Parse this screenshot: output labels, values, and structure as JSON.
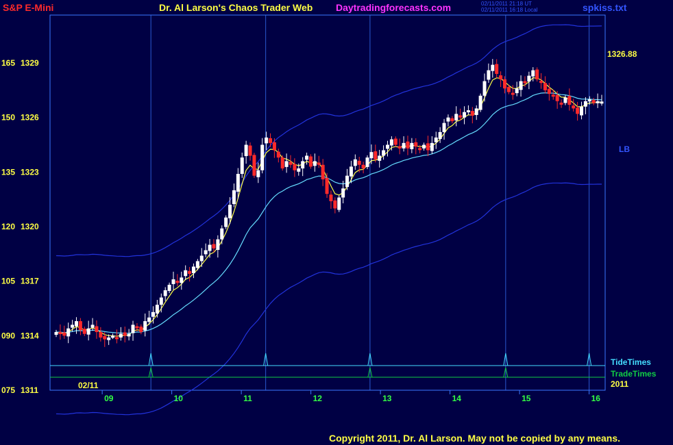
{
  "header": {
    "symbol": "S&P E-Mini",
    "title": "Dr. Al Larson's Chaos Trader Web",
    "site": "Daytradingforecasts.com",
    "stamp_ut": "02/11/2011 21:18 UT",
    "stamp_local": "02/11/2011 16:18 Local",
    "file": "spkiss.txt"
  },
  "footer": {
    "copyright": "Copyright 2011, Dr. Al Larson. May not be copied by any means."
  },
  "labels": {
    "last_price": "1326.88",
    "lb": "LB",
    "tide_times": "TideTimes",
    "trade_times": "TradeTimes",
    "date": "02/11",
    "year": "2011"
  },
  "colors": {
    "background": "#000044",
    "frame": "#3a78ff",
    "up_candle": "#ffffff",
    "down_candle": "#ff2a2a",
    "ema_fast": "#ffff44",
    "ema_slow": "#66ddff",
    "band": "#2233dd",
    "tide": "#44ddff",
    "trade": "#11cc44",
    "price_label": "#ffff44",
    "time_label": "#33ff44"
  },
  "chart_data": {
    "type": "candlestick",
    "instrument": "S&P E-Mini",
    "y_labels": [
      {
        "left": "165",
        "price": "1329"
      },
      {
        "left": "150",
        "price": "1326"
      },
      {
        "left": "135",
        "price": "1323"
      },
      {
        "left": "120",
        "price": "1320"
      },
      {
        "left": "105",
        "price": "1317"
      },
      {
        "left": "090",
        "price": "1314"
      },
      {
        "left": "075",
        "price": "1311"
      }
    ],
    "ylim": [
      1311,
      1329.3
    ],
    "x_ticks": [
      "09",
      "10",
      "11",
      "12",
      "13",
      "14",
      "15",
      "16"
    ],
    "xlim": [
      8.25,
      16.1
    ],
    "time_cycle_lines": [
      9.7,
      11.35,
      12.85,
      14.8,
      16.0
    ],
    "last_price": 1326.88,
    "candles_close": [
      1314.2,
      1314.1,
      1314.0,
      1314.4,
      1314.6,
      1314.8,
      1314.3,
      1314.1,
      1314.4,
      1314.6,
      1314.2,
      1313.9,
      1313.8,
      1313.9,
      1314.0,
      1313.9,
      1314.1,
      1314.0,
      1314.1,
      1314.6,
      1314.5,
      1314.2,
      1314.8,
      1315.0,
      1315.3,
      1315.7,
      1316.1,
      1316.5,
      1316.8,
      1317.1,
      1316.9,
      1317.2,
      1317.6,
      1317.4,
      1317.8,
      1318.1,
      1318.4,
      1318.7,
      1319.0,
      1318.8,
      1319.3,
      1319.9,
      1320.5,
      1321.2,
      1322.0,
      1322.9,
      1323.8,
      1324.5,
      1323.9,
      1322.8,
      1323.1,
      1324.5,
      1324.9,
      1324.6,
      1324.2,
      1323.8,
      1323.2,
      1323.6,
      1323.4,
      1323.1,
      1323.2,
      1323.6,
      1323.9,
      1323.3,
      1323.6,
      1323.4,
      1322.6,
      1321.8,
      1321.4,
      1321.0,
      1321.6,
      1322.1,
      1322.8,
      1323.3,
      1323.7,
      1323.4,
      1323.2,
      1323.8,
      1324.1,
      1323.7,
      1323.9,
      1324.2,
      1324.5,
      1324.8,
      1324.5,
      1324.3,
      1324.6,
      1324.3,
      1324.6,
      1324.4,
      1324.3,
      1324.5,
      1324.2,
      1324.6,
      1324.9,
      1325.2,
      1325.7,
      1326.0,
      1325.8,
      1326.2,
      1326.0,
      1326.3,
      1326.4,
      1326.1,
      1326.5,
      1327.2,
      1328.0,
      1328.6,
      1328.9,
      1328.4,
      1328.1,
      1327.6,
      1327.4,
      1327.3,
      1327.6,
      1328.0,
      1327.9,
      1328.3,
      1328.6,
      1328.1,
      1327.9,
      1327.5,
      1327.3,
      1327.2,
      1326.9,
      1326.8,
      1327.1,
      1326.7,
      1326.5,
      1326.2,
      1326.6,
      1326.9,
      1327.0,
      1326.8,
      1326.9,
      1326.88
    ],
    "series": [
      {
        "name": "TideTimes",
        "values": [
          9.7,
          11.35,
          12.85,
          14.8,
          16.0
        ]
      },
      {
        "name": "TradeTimes",
        "values": [
          9.7,
          12.85,
          14.8
        ]
      }
    ]
  }
}
